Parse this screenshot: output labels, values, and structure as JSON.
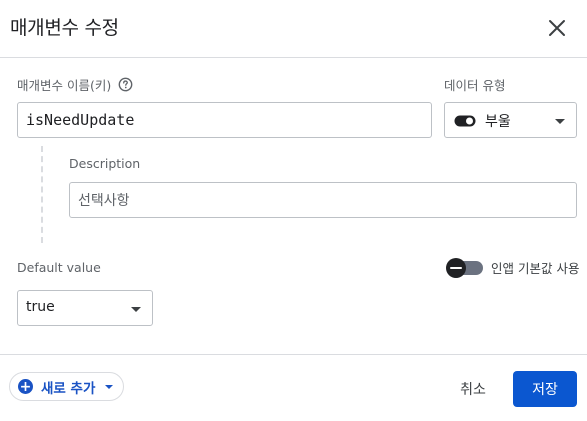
{
  "dialog": {
    "title": "매개변수 수정"
  },
  "param": {
    "name_label": "매개변수 이름(키)",
    "name_value": "isNeedUpdate"
  },
  "data_type": {
    "label": "데이터 유형",
    "selected": "부울"
  },
  "description": {
    "label": "Description",
    "placeholder": "선택사항"
  },
  "default_value": {
    "label": "Default value",
    "selected": "true"
  },
  "in_app_default": {
    "label": "인앱 기본값 사용",
    "enabled": false
  },
  "footer": {
    "add_new_label": "새로 추가",
    "cancel_label": "취소",
    "save_label": "저장"
  },
  "colors": {
    "primary": "#0b57d0",
    "link": "#1a53c4",
    "border": "#bdc1c6",
    "divider": "#dadce0"
  }
}
